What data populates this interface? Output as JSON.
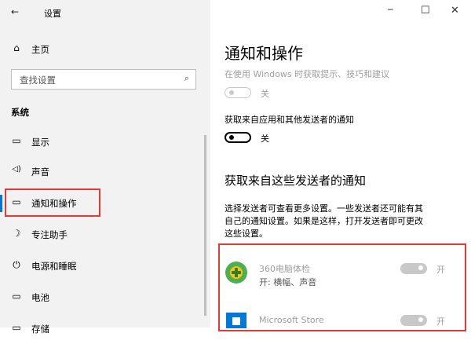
{
  "window": {
    "back_glyph": "←",
    "title": "设置",
    "minimize_glyph": "─",
    "maximize_glyph": "☐",
    "close_glyph": "✕"
  },
  "sidebar": {
    "home_label": "主页",
    "search_placeholder": "查找设置",
    "section_label": "系统",
    "items": [
      {
        "label": "显示",
        "icon": "monitor-icon",
        "glyph": "▭"
      },
      {
        "label": "声音",
        "icon": "speaker-icon",
        "glyph": "◁)"
      },
      {
        "label": "通知和操作",
        "icon": "notification-icon",
        "glyph": "▭"
      },
      {
        "label": "专注助手",
        "icon": "moon-icon",
        "glyph": "☽"
      },
      {
        "label": "电源和睡眠",
        "icon": "power-icon",
        "glyph": "⏻"
      },
      {
        "label": "电池",
        "icon": "battery-icon",
        "glyph": "▭"
      },
      {
        "label": "存储",
        "icon": "storage-icon",
        "glyph": "▭"
      }
    ],
    "selected_index": 2
  },
  "main": {
    "title": "通知和操作",
    "tips_label": "在使用 Windows 时获取提示、技巧和建议",
    "tips_toggle_state": "关",
    "apps_notif_label": "获取来自应用和其他发送者的通知",
    "apps_notif_toggle_state": "关",
    "senders_heading": "获取来自这些发送者的通知",
    "senders_desc": [
      "选择发送者可查看更多设置。一些发送者还可能有其",
      "自己的通知设置。如果是这样，打开发送者即可更改",
      "这些设置。"
    ],
    "senders": [
      {
        "name": "360电脑体检",
        "detail": "开: 横幅、声音",
        "toggle_state": "开",
        "icon": "360-shield-icon"
      },
      {
        "name": "Microsoft Store",
        "detail": "",
        "toggle_state": "开",
        "icon": "store-bag-icon"
      }
    ]
  },
  "colors": {
    "accent_red": "#e53935",
    "store_blue": "#0078d7",
    "green_360": "#4caf50"
  }
}
